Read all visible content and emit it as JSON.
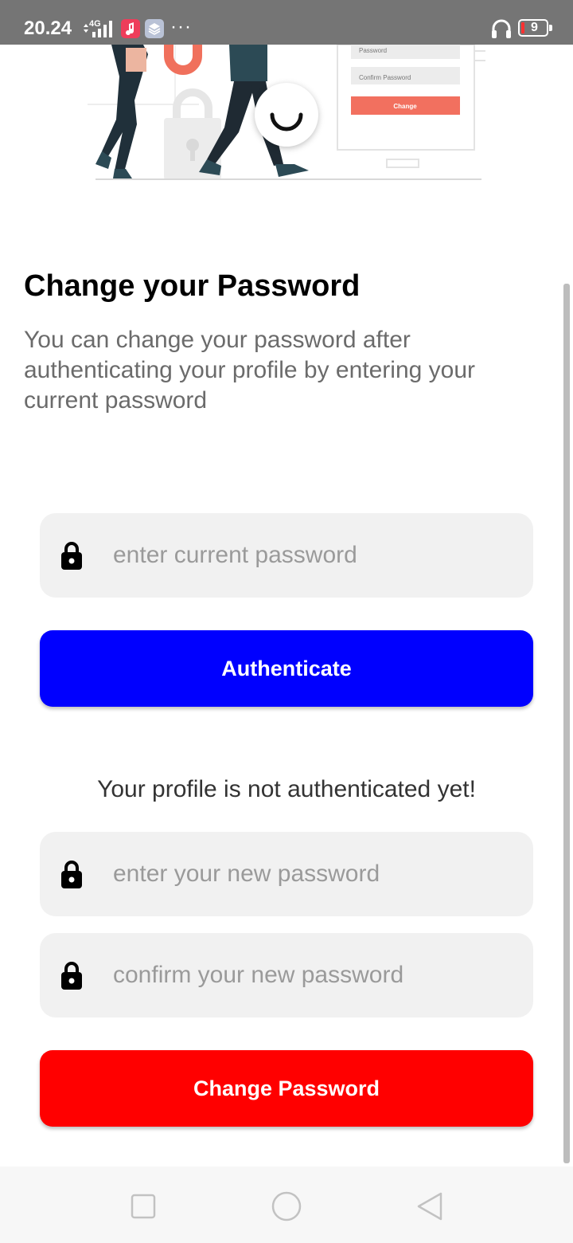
{
  "status_bar": {
    "time": "20.24",
    "network": "4G",
    "battery": "9"
  },
  "illustration": {
    "form_labels": [
      "Password",
      "Confirm Password"
    ],
    "button_label": "Change"
  },
  "header": {
    "title": "Change your Password",
    "description": "You can change your password after authenticating your profile by entering your current password"
  },
  "current_password": {
    "placeholder": "enter current password"
  },
  "authenticate_button": {
    "label": "Authenticate",
    "color": "#0000ff"
  },
  "auth_status": "Your profile is not authenticated yet!",
  "new_password": {
    "placeholder": "enter your new password"
  },
  "confirm_password": {
    "placeholder": "confirm your new password"
  },
  "change_button": {
    "label": "Change Password",
    "color": "#ff0000"
  },
  "icons": {
    "field_icon": "lock-icon",
    "nav": [
      "square-icon",
      "circle-icon",
      "triangle-back-icon"
    ]
  }
}
